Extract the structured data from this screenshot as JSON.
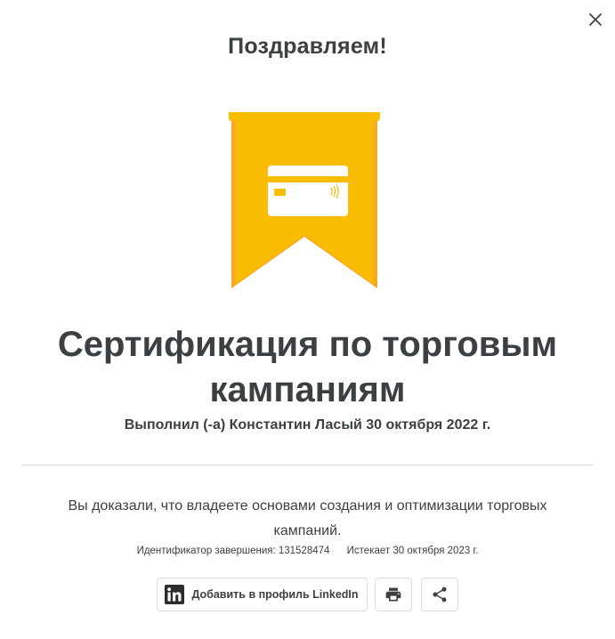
{
  "dialog": {
    "close_icon": "close-icon",
    "headline": "Поздравляем!",
    "badge": {
      "icon": "credit-card-icon",
      "ribbon_color": "#fbbc04",
      "ribbon_edge_color": "#f9a825",
      "card_color": "#ffffff"
    },
    "certificate_title": "Сертификация по торговым кампаниям",
    "completed_by": "Выполнил (-а) Константин Ласый 30 октября 2022 г.",
    "description": "Вы доказали, что владеете основами создания и оптимизации торговых кампаний.",
    "completion_id": "Идентификатор завершения: 131528474",
    "expires": "Истекает 30 октября 2023 г.",
    "actions": {
      "linkedin_label": "Добавить в профиль LinkedIn",
      "linkedin_icon": "linkedin-icon",
      "print_icon": "print-icon",
      "share_icon": "share-icon"
    }
  },
  "colors": {
    "text": "#3c4043",
    "border": "#dadce0",
    "linkedin": "#2d2d2d"
  }
}
